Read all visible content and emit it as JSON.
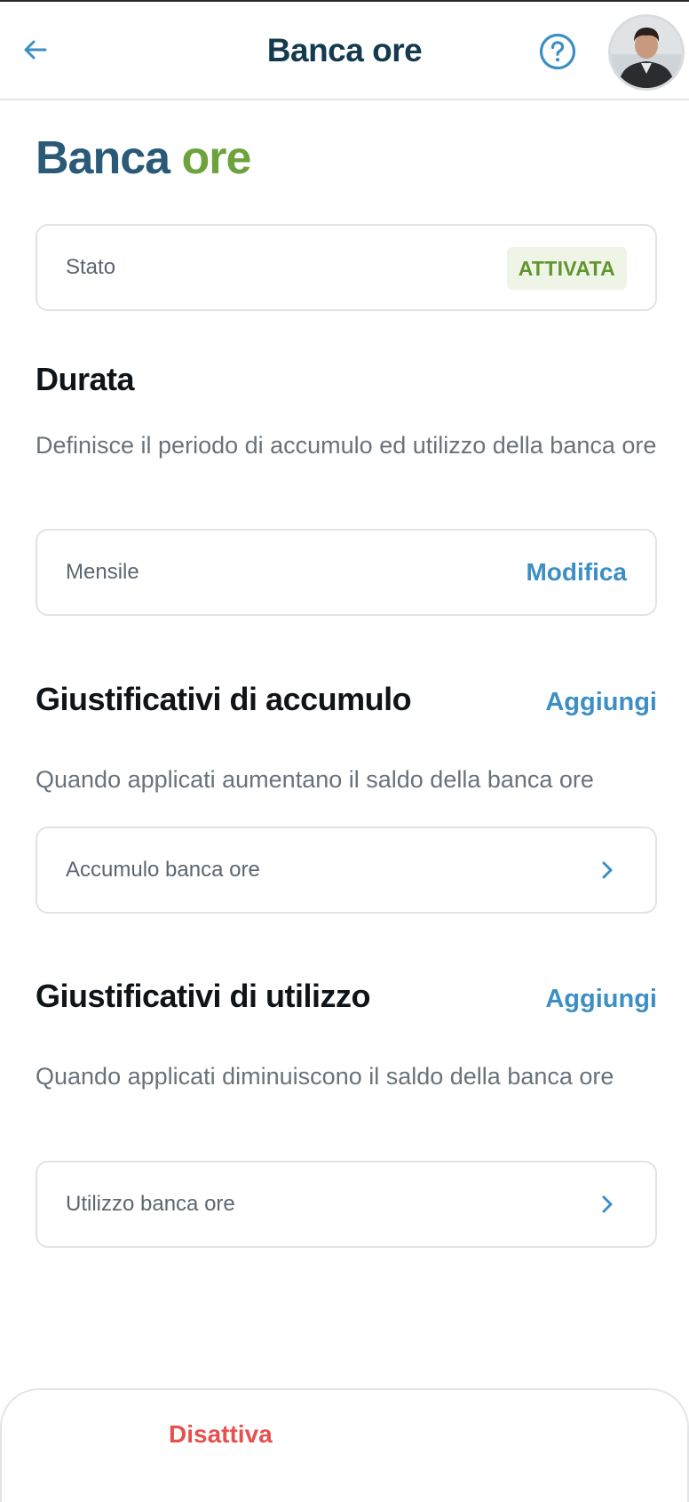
{
  "header": {
    "title": "Banca ore",
    "back_icon": "arrow-left-icon",
    "help_icon": "question-circle-icon",
    "avatar": "user-avatar"
  },
  "page": {
    "title_part1": "Banca",
    "title_part2": "ore"
  },
  "status": {
    "label": "Stato",
    "badge": "ATTIVATA"
  },
  "duration": {
    "heading": "Durata",
    "description": "Definisce il periodo di accumulo ed utilizzo della banca ore",
    "value": "Mensile",
    "action": "Modifica"
  },
  "accrual": {
    "heading": "Giustificativi di accumulo",
    "action": "Aggiungi",
    "description": "Quando applicati aumentano il saldo della banca ore",
    "item": "Accumulo banca ore"
  },
  "usage": {
    "heading": "Giustificativi di utilizzo",
    "action": "Aggiungi",
    "description": "Quando applicati diminuiscono il saldo della banca ore",
    "item": "Utilizzo banca ore"
  },
  "footer": {
    "deactivate": "Disattiva"
  },
  "colors": {
    "primary_blue": "#3c8fc4",
    "title_dark": "#143a4f",
    "brand_green": "#6da33d",
    "danger_red": "#e4514f"
  }
}
